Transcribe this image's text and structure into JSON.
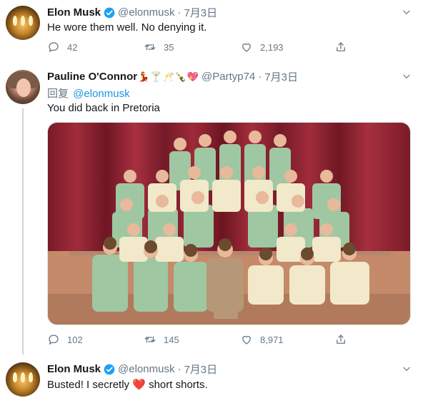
{
  "tweets": [
    {
      "name": "Elon Musk",
      "handle": "@elonmusk",
      "dot": "·",
      "date": "7月3日",
      "text": "He wore them well. No denying it.",
      "replies": "42",
      "retweets": "35",
      "likes": "2,193"
    },
    {
      "name": "Pauline O'Connor",
      "emojis": [
        "💃",
        "🍸",
        "🥂",
        "🍾",
        "💖"
      ],
      "handle": "@Partyp74",
      "dot": "·",
      "date": "7月3日",
      "reply_label": "回复",
      "reply_to": "@elonmusk",
      "text": "You did back in Pretoria",
      "replies": "102",
      "retweets": "145",
      "likes": "8,971"
    },
    {
      "name": "Elon Musk",
      "handle": "@elonmusk",
      "dot": "·",
      "date": "7月3日",
      "text_before": "Busted! I secretly",
      "text_heart": "❤️",
      "text_after": "short shorts."
    }
  ],
  "colors": {
    "verified": "#1da1f2",
    "link": "#1b95e0",
    "secondary": "#657786",
    "heart": "#e0245e"
  },
  "icons": [
    "chevron-down-icon",
    "verified-badge-icon",
    "reply-icon",
    "retweet-icon",
    "like-icon",
    "share-icon"
  ]
}
